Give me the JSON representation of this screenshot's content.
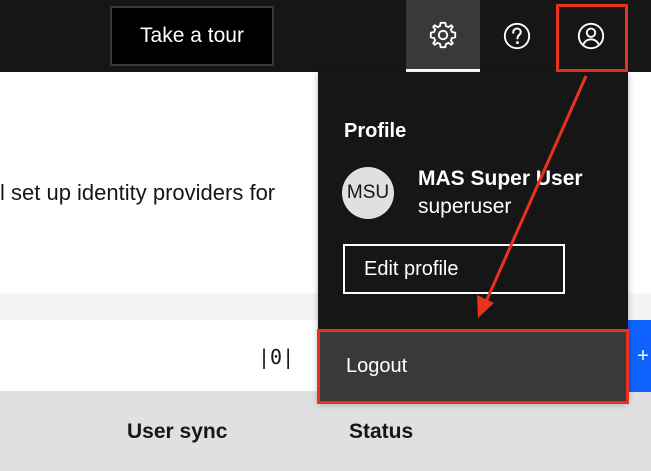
{
  "header": {
    "tour_label": "Take a tour",
    "icons": {
      "settings": "gear-icon",
      "help": "help-icon",
      "user": "user-avatar-icon"
    }
  },
  "page": {
    "description_fragment": "l set up identity providers for",
    "columns_icon": "column-settings-icon",
    "add_icon": "+",
    "table_headers": [
      "User sync",
      "Status"
    ]
  },
  "profile_panel": {
    "title": "Profile",
    "avatar_initials": "MSU",
    "display_name": "MAS Super User",
    "username": "superuser",
    "edit_label": "Edit profile",
    "logout_label": "Logout"
  },
  "annotation": {
    "color": "#e8321e"
  }
}
